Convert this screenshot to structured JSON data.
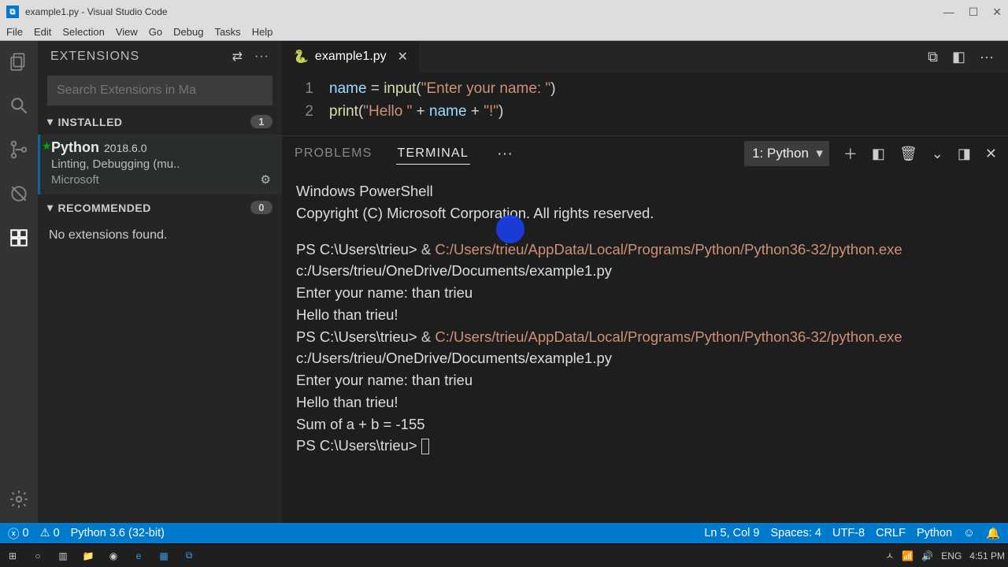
{
  "window": {
    "title": "example1.py - Visual Studio Code"
  },
  "menu": {
    "file": "File",
    "edit": "Edit",
    "selection": "Selection",
    "view": "View",
    "go": "Go",
    "debug": "Debug",
    "tasks": "Tasks",
    "help": "Help"
  },
  "sidebar": {
    "title": "EXTENSIONS",
    "search_placeholder": "Search Extensions in Ma",
    "installed_label": "INSTALLED",
    "installed_count": "1",
    "recommended_label": "RECOMMENDED",
    "recommended_count": "0",
    "no_extensions": "No extensions found.",
    "ext": {
      "name": "Python",
      "version": "2018.6.0",
      "desc": "Linting, Debugging (mu..",
      "publisher": "Microsoft"
    }
  },
  "tab": {
    "filename": "example1.py"
  },
  "code": {
    "l1": {
      "num": "1",
      "var": "name",
      "eq": " = ",
      "fn": "input",
      "p1": "(",
      "str": "\"Enter your name: \"",
      "p2": ")"
    },
    "l2": {
      "num": "2",
      "fn": "print",
      "p1": "(",
      "s1": "\"Hello \"",
      "op1": " + ",
      "var": "name",
      "op2": " + ",
      "s2": "\"!\"",
      "p2": ")"
    }
  },
  "panel": {
    "problems": "PROBLEMS",
    "terminal": "TERMINAL",
    "selector": "1: Python"
  },
  "terminal": {
    "l1": "Windows PowerShell",
    "l2": "Copyright (C) Microsoft Corporation. All rights reserved.",
    "ps1": "PS C:\\Users\\trieu> ",
    "amp": "& ",
    "exe": "C:/Users/trieu/AppData/Local/Programs/Python/Python36-32/python.exe",
    "script": " c:/Users/trieu/OneDrive/Documents/example1.py",
    "enter": "Enter your name: than trieu",
    "hello": "Hello than trieu!",
    "sum": "Sum of a + b =  -155",
    "ps_last": "PS C:\\Users\\trieu> "
  },
  "status": {
    "errors": "0",
    "warnings": "0",
    "python": "Python 3.6 (32-bit)",
    "ln": "Ln 5, Col 9",
    "spaces": "Spaces: 4",
    "enc": "UTF-8",
    "eol": "CRLF",
    "lang": "Python"
  },
  "tray": {
    "up": "ㅅ",
    "wifi": "📶",
    "vol": "🔊",
    "lang": "ENG",
    "time": "4:51 PM"
  }
}
